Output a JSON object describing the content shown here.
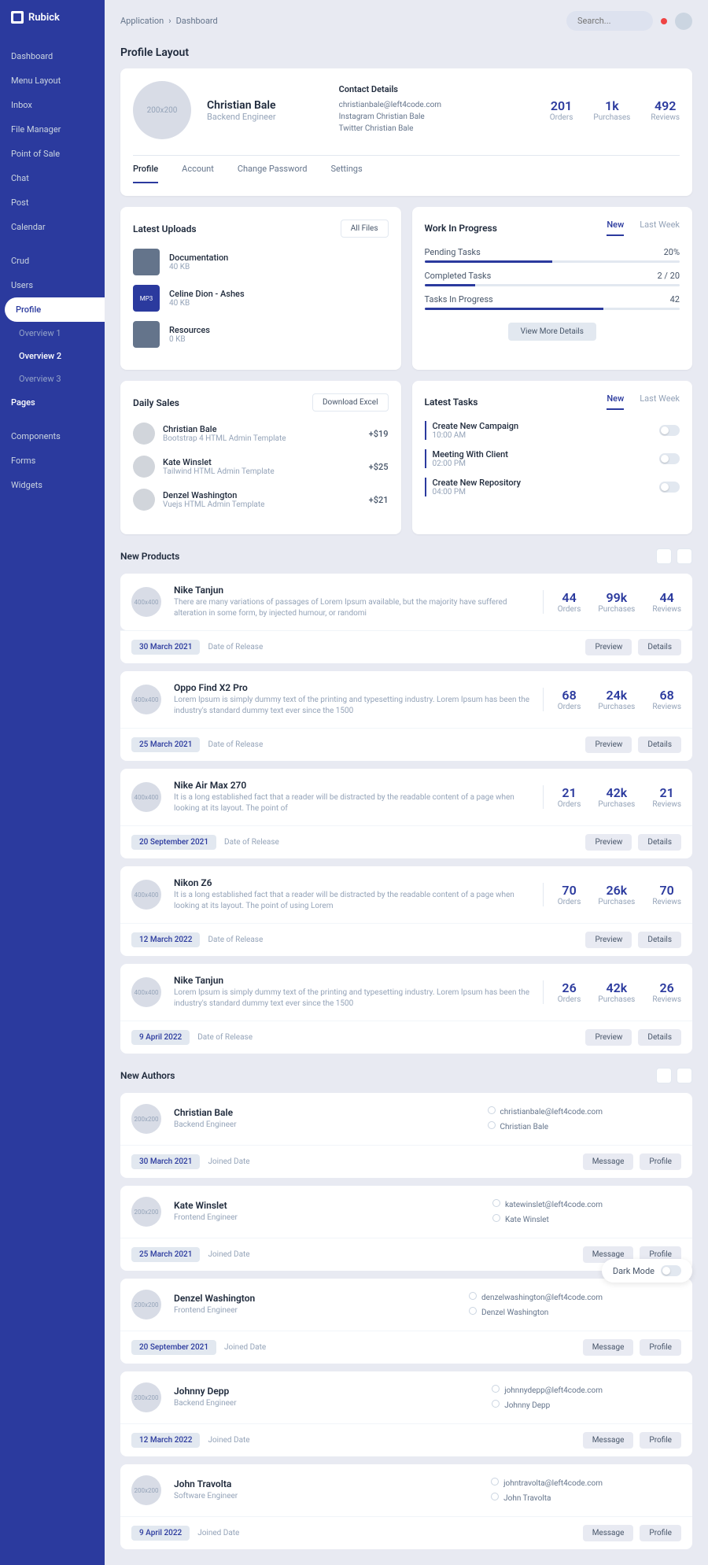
{
  "brand": "Rubick",
  "breadcrumb": {
    "app": "Application",
    "page": "Dashboard"
  },
  "search": {
    "placeholder": "Search..."
  },
  "sidebar": {
    "items": [
      "Dashboard",
      "Menu Layout",
      "Inbox",
      "File Manager",
      "Point of Sale",
      "Chat",
      "Post",
      "Calendar"
    ],
    "items2": [
      "Crud",
      "Users",
      "Profile"
    ],
    "subs": [
      "Overview 1",
      "Overview 2",
      "Overview 3"
    ],
    "items3": [
      "Pages"
    ],
    "items4": [
      "Components",
      "Forms",
      "Widgets"
    ]
  },
  "page_title": "Profile Layout",
  "profile": {
    "name": "Christian Bale",
    "role": "Backend Engineer",
    "imgText": "200x200",
    "contact_title": "Contact Details",
    "email": "christianbale@left4code.com",
    "instagram": "Instagram Christian Bale",
    "twitter": "Twitter Christian Bale",
    "stats": [
      {
        "v": "201",
        "l": "Orders"
      },
      {
        "v": "1k",
        "l": "Purchases"
      },
      {
        "v": "492",
        "l": "Reviews"
      }
    ],
    "tabs": [
      "Profile",
      "Account",
      "Change Password",
      "Settings"
    ]
  },
  "uploads": {
    "title": "Latest Uploads",
    "btn": "All Files",
    "files": [
      {
        "name": "Documentation",
        "size": "40 KB",
        "type": ""
      },
      {
        "name": "Celine Dion - Ashes",
        "size": "40 KB",
        "type": "MP3"
      },
      {
        "name": "Resources",
        "size": "0 KB",
        "type": ""
      }
    ]
  },
  "wip": {
    "title": "Work In Progress",
    "tabs": [
      "New",
      "Last Week"
    ],
    "rows": [
      {
        "label": "Pending Tasks",
        "val": "20%",
        "pct": 50
      },
      {
        "label": "Completed Tasks",
        "val": "2 / 20",
        "pct": 20
      },
      {
        "label": "Tasks In Progress",
        "val": "42",
        "pct": 70
      }
    ],
    "btn": "View More Details"
  },
  "sales": {
    "title": "Daily Sales",
    "btn": "Download Excel",
    "rows": [
      {
        "name": "Christian Bale",
        "desc": "Bootstrap 4 HTML Admin Template",
        "amt": "+$19"
      },
      {
        "name": "Kate Winslet",
        "desc": "Tailwind HTML Admin Template",
        "amt": "+$25"
      },
      {
        "name": "Denzel Washington",
        "desc": "Vuejs HTML Admin Template",
        "amt": "+$21"
      }
    ]
  },
  "tasks": {
    "title": "Latest Tasks",
    "tabs": [
      "New",
      "Last Week"
    ],
    "rows": [
      {
        "name": "Create New Campaign",
        "time": "10:00 AM"
      },
      {
        "name": "Meeting With Client",
        "time": "02:00 PM"
      },
      {
        "name": "Create New Repository",
        "time": "04:00 PM"
      }
    ]
  },
  "products": {
    "title": "New Products",
    "items": [
      {
        "name": "Nike Tanjun",
        "desc": "There are many variations of passages of Lorem Ipsum available, but the majority have suffered alteration in some form, by injected humour, or randomi",
        "stats": [
          {
            "v": "44",
            "l": "Orders"
          },
          {
            "v": "99k",
            "l": "Purchases"
          },
          {
            "v": "44",
            "l": "Reviews"
          }
        ],
        "date": "30 March 2021"
      },
      {
        "name": "Oppo Find X2 Pro",
        "desc": "Lorem Ipsum is simply dummy text of the printing and typesetting industry. Lorem Ipsum has been the industry's standard dummy text ever since the 1500",
        "stats": [
          {
            "v": "68",
            "l": "Orders"
          },
          {
            "v": "24k",
            "l": "Purchases"
          },
          {
            "v": "68",
            "l": "Reviews"
          }
        ],
        "date": "25 March 2021"
      },
      {
        "name": "Nike Air Max 270",
        "desc": "It is a long established fact that a reader will be distracted by the readable content of a page when looking at its layout. The point of",
        "stats": [
          {
            "v": "21",
            "l": "Orders"
          },
          {
            "v": "42k",
            "l": "Purchases"
          },
          {
            "v": "21",
            "l": "Reviews"
          }
        ],
        "date": "20 September 2021"
      },
      {
        "name": "Nikon Z6",
        "desc": "It is a long established fact that a reader will be distracted by the readable content of a page when looking at its layout. The point of using Lorem",
        "stats": [
          {
            "v": "70",
            "l": "Orders"
          },
          {
            "v": "26k",
            "l": "Purchases"
          },
          {
            "v": "70",
            "l": "Reviews"
          }
        ],
        "date": "12 March 2022"
      },
      {
        "name": "Nike Tanjun",
        "desc": "Lorem Ipsum is simply dummy text of the printing and typesetting industry. Lorem Ipsum has been the industry's standard dummy text ever since the 1500",
        "stats": [
          {
            "v": "26",
            "l": "Orders"
          },
          {
            "v": "42k",
            "l": "Purchases"
          },
          {
            "v": "26",
            "l": "Reviews"
          }
        ],
        "date": "9 April 2022"
      }
    ],
    "date_label": "Date of Release",
    "preview": "Preview",
    "details": "Details",
    "imgText": "400x400"
  },
  "authors": {
    "title": "New Authors",
    "joined": "Joined Date",
    "msg": "Message",
    "prof": "Profile",
    "imgText": "200x200",
    "items": [
      {
        "name": "Christian Bale",
        "role": "Backend Engineer",
        "email": "christianbale@left4code.com",
        "handle": "Christian Bale",
        "date": "30 March 2021"
      },
      {
        "name": "Kate Winslet",
        "role": "Frontend Engineer",
        "email": "katewinslet@left4code.com",
        "handle": "Kate Winslet",
        "date": "25 March 2021"
      },
      {
        "name": "Denzel Washington",
        "role": "Frontend Engineer",
        "email": "denzelwashington@left4code.com",
        "handle": "Denzel Washington",
        "date": "20 September 2021"
      },
      {
        "name": "Johnny Depp",
        "role": "Backend Engineer",
        "email": "johnnydepp@left4code.com",
        "handle": "Johnny Depp",
        "date": "12 March 2022"
      },
      {
        "name": "John Travolta",
        "role": "Software Engineer",
        "email": "johntravolta@left4code.com",
        "handle": "John Travolta",
        "date": "9 April 2022"
      }
    ]
  },
  "dark_mode": "Dark Mode"
}
